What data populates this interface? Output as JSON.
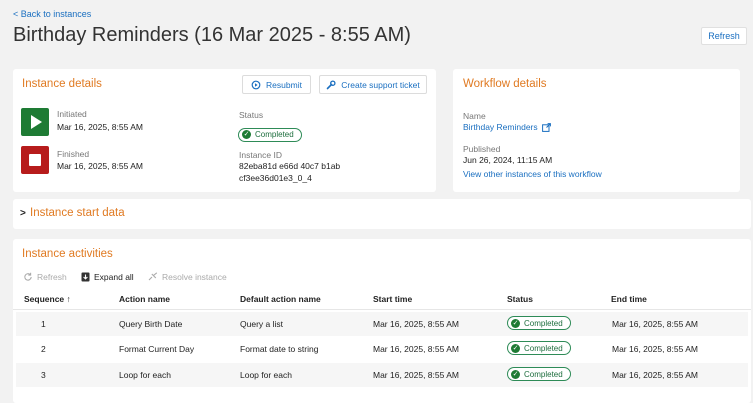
{
  "header": {
    "back_link": "< Back to instances",
    "title": "Birthday Reminders (16 Mar 2025 - 8:55 AM)",
    "refresh_label": "Refresh"
  },
  "instance_details": {
    "title": "Instance details",
    "resubmit_label": "Resubmit",
    "support_ticket_label": "Create support ticket",
    "initiated_label": "Initiated",
    "initiated_value": "Mar 16, 2025, 8:55 AM",
    "finished_label": "Finished",
    "finished_value": "Mar 16, 2025, 8:55 AM",
    "status_label": "Status",
    "status_value": "Completed",
    "instance_id_label": "Instance ID",
    "instance_id_line1": "82eba81d e66d 40c7 b1ab",
    "instance_id_line2": "cf3ee36d01e3_0_4"
  },
  "workflow_details": {
    "title": "Workflow details",
    "name_label": "Name",
    "name_value": "Birthday Reminders",
    "published_label": "Published",
    "published_value": "Jun 26, 2024, 11:15 AM",
    "view_other_link": "View other instances of this workflow"
  },
  "start_data": {
    "title": "Instance start data"
  },
  "activities": {
    "title": "Instance activities",
    "toolbar": {
      "refresh": "Refresh",
      "expand_all": "Expand all",
      "resolve": "Resolve instance"
    },
    "columns": [
      "Sequence ↑",
      "Action name",
      "Default action name",
      "Start time",
      "Status",
      "End time"
    ],
    "rows": [
      {
        "sequence": "1",
        "action": "Query Birth Date",
        "default_action": "Query a list",
        "start": "Mar 16, 2025, 8:55 AM",
        "status": "Completed",
        "end": "Mar 16, 2025, 8:55 AM"
      },
      {
        "sequence": "2",
        "action": "Format Current Day",
        "default_action": "Format date to string",
        "start": "Mar 16, 2025, 8:55 AM",
        "status": "Completed",
        "end": "Mar 16, 2025, 8:55 AM"
      },
      {
        "sequence": "3",
        "action": "Loop for each",
        "default_action": "Loop for each",
        "start": "Mar 16, 2025, 8:55 AM",
        "status": "Completed",
        "end": "Mar 16, 2025, 8:55 AM"
      }
    ]
  },
  "colors": {
    "accent_orange": "#e07a22",
    "link_blue": "#1a6fc0",
    "success_green": "#1e7b34",
    "finished_red": "#b71c1c"
  }
}
